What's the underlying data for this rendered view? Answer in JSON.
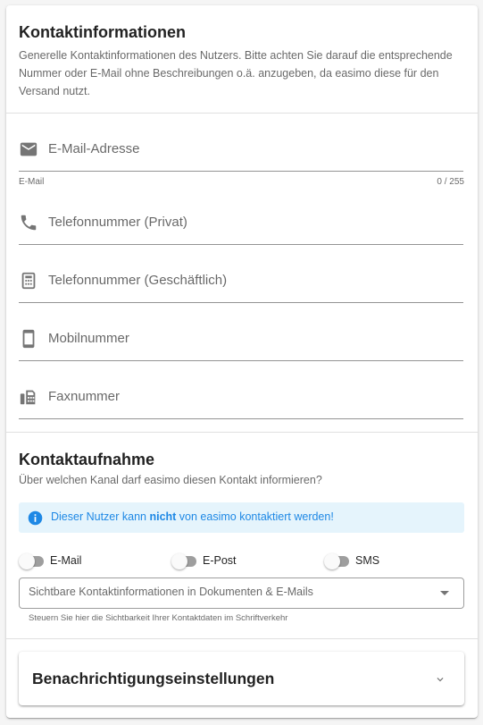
{
  "contact": {
    "title": "Kontaktinformationen",
    "description": "Generelle Kontaktinformationen des Nutzers. Bitte achten Sie darauf die entsprechende Nummer oder E-Mail ohne Beschreibungen o.ä. anzugeben, da easimo diese für den Versand nutzt.",
    "fields": [
      {
        "label": "E-Mail-Adresse",
        "icon": "email-icon",
        "hint": "E-Mail",
        "counter": "0 / 255"
      },
      {
        "label": "Telefonnummer (Privat)",
        "icon": "phone-icon"
      },
      {
        "label": "Telefonnummer (Geschäftlich)",
        "icon": "business-phone-icon"
      },
      {
        "label": "Mobilnummer",
        "icon": "mobile-icon"
      },
      {
        "label": "Faxnummer",
        "icon": "fax-icon"
      }
    ]
  },
  "outreach": {
    "title": "Kontaktaufnahme",
    "question": "Über welchen Kanal darf easimo diesen Kontakt informieren?",
    "alert": {
      "before": "Dieser Nutzer kann ",
      "emphasis": "nicht",
      "after": " von easimo kontaktiert werden!",
      "color": "#1e88e5",
      "background": "#e5f4fc"
    },
    "channels": [
      {
        "label": "E-Mail",
        "enabled": false
      },
      {
        "label": "E-Post",
        "enabled": false
      },
      {
        "label": "SMS",
        "enabled": false
      }
    ],
    "visibility_select": {
      "value": "Sichtbare Kontaktinformationen in Dokumenten & E-Mails",
      "hint": "Steuern Sie hier die Sichtbarkeit Ihrer Kontaktdaten im Schriftverkehr"
    }
  },
  "notifications": {
    "title": "Benachrichtigungseinstellungen"
  }
}
